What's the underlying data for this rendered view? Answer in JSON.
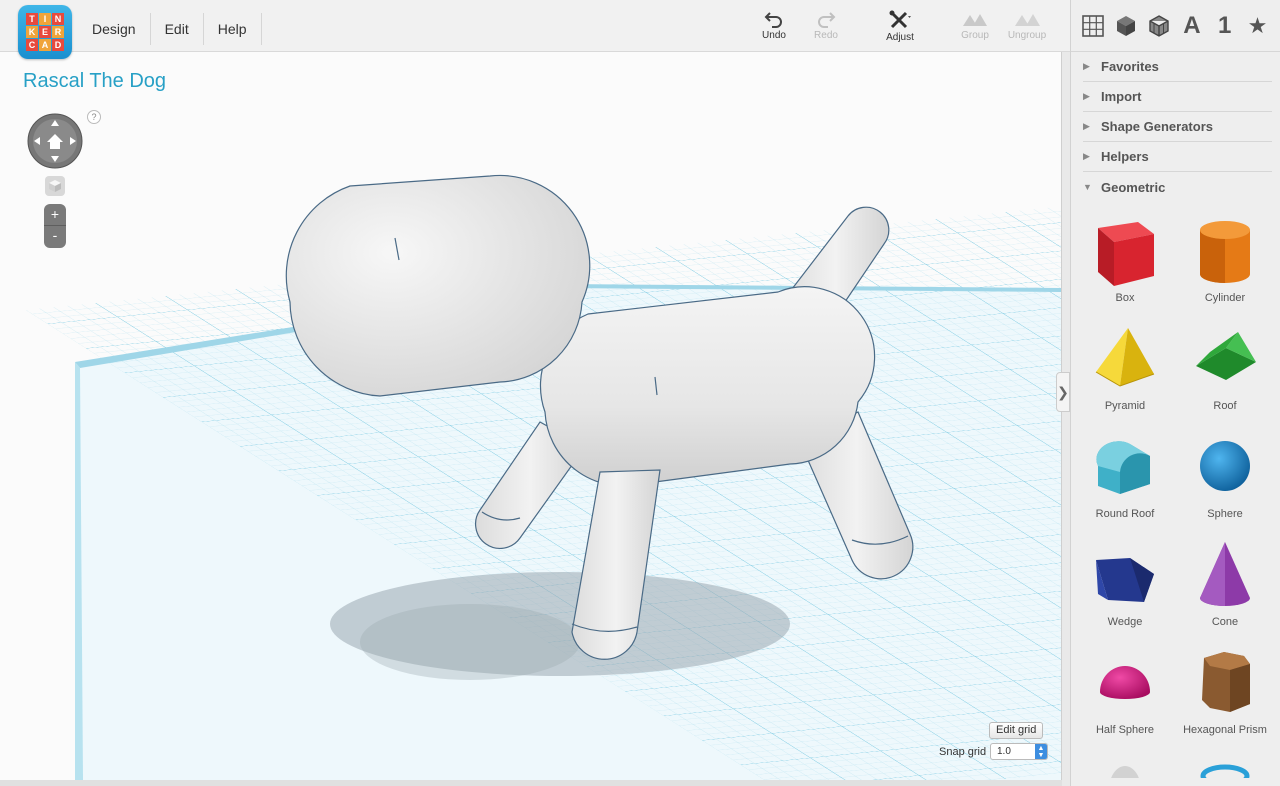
{
  "app": {
    "logo_letters": [
      "TIN",
      "KER",
      "CAD"
    ],
    "menu": [
      "Design",
      "Edit",
      "Help"
    ]
  },
  "toolbar": {
    "undo": "Undo",
    "redo": "Redo",
    "adjust": "Adjust",
    "group": "Group",
    "ungroup": "Ungroup"
  },
  "viewbar": {
    "text_tool": "A",
    "number_tool": "1"
  },
  "canvas": {
    "title": "Rascal The Dog",
    "help": "?",
    "zoom_in": "+",
    "zoom_out": "-",
    "edit_grid": "Edit grid",
    "snap_label": "Snap grid",
    "snap_value": "1.0"
  },
  "panel": {
    "categories": [
      {
        "label": "Favorites",
        "expanded": false
      },
      {
        "label": "Import",
        "expanded": false
      },
      {
        "label": "Shape Generators",
        "expanded": false
      },
      {
        "label": "Helpers",
        "expanded": false
      },
      {
        "label": "Geometric",
        "expanded": true
      }
    ],
    "shapes": [
      {
        "label": "Box",
        "color": "#d8242f"
      },
      {
        "label": "Cylinder",
        "color": "#e57a16"
      },
      {
        "label": "Pyramid",
        "color": "#f2cf1d"
      },
      {
        "label": "Roof",
        "color": "#2fa83b"
      },
      {
        "label": "Round Roof",
        "color": "#3fb0c8"
      },
      {
        "label": "Sphere",
        "color": "#1a84c9"
      },
      {
        "label": "Wedge",
        "color": "#24388e"
      },
      {
        "label": "Cone",
        "color": "#8d3aa8"
      },
      {
        "label": "Half Sphere",
        "color": "#d6157f"
      },
      {
        "label": "Hexagonal Prism",
        "color": "#8a5a30"
      }
    ]
  },
  "colors": {
    "accent": "#27a0c6",
    "grid_line": "#7ccde4",
    "workplane": "#e9f6fb",
    "model": "#e9e9e9"
  }
}
